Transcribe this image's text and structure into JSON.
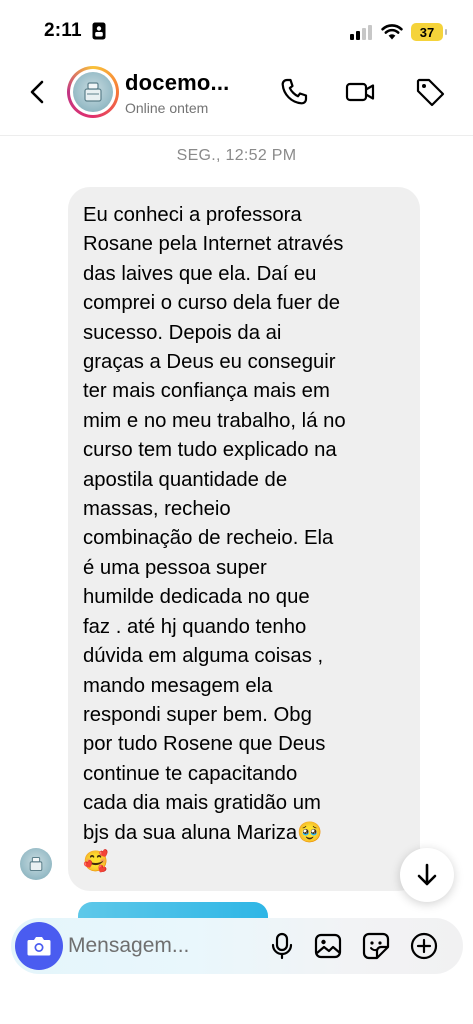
{
  "status_bar": {
    "time": "2:11",
    "battery": "37"
  },
  "header": {
    "contact_name": "docemo...",
    "contact_status": "Online ontem"
  },
  "timestamp": "SEG., 12:52 PM",
  "message": {
    "text": "Eu conheci a professora\nRosane pela Internet através\ndas laives que ela. Daí eu\ncomprei o curso dela fuer de\nsucesso. Depois da  ai\ngraças a Deus eu conseguir\nter mais confiança mais em\nmim e no meu trabalho, lá no\ncurso tem tudo explicado na\napostila quantidade de\nmassas, recheio\ncombinação de recheio. Ela\né uma pessoa  super\nhumilde dedicada  no que\nfaz . até hj quando tenho\ndúvida em alguma coisas ,\nmando mesagem ela\nrespondi super bem.  Obg\npor tudo Rosene que Deus\ncontinue te capacitando\ncada dia mais gratidão um\nbjs da sua aluna Mariza🥹\n🥰"
  },
  "composer": {
    "placeholder": "Mensagem..."
  },
  "colors": {
    "accent_blue": "#4a5cf0",
    "bubble_bg": "#efefef",
    "battery_yellow": "#f5d33a"
  }
}
